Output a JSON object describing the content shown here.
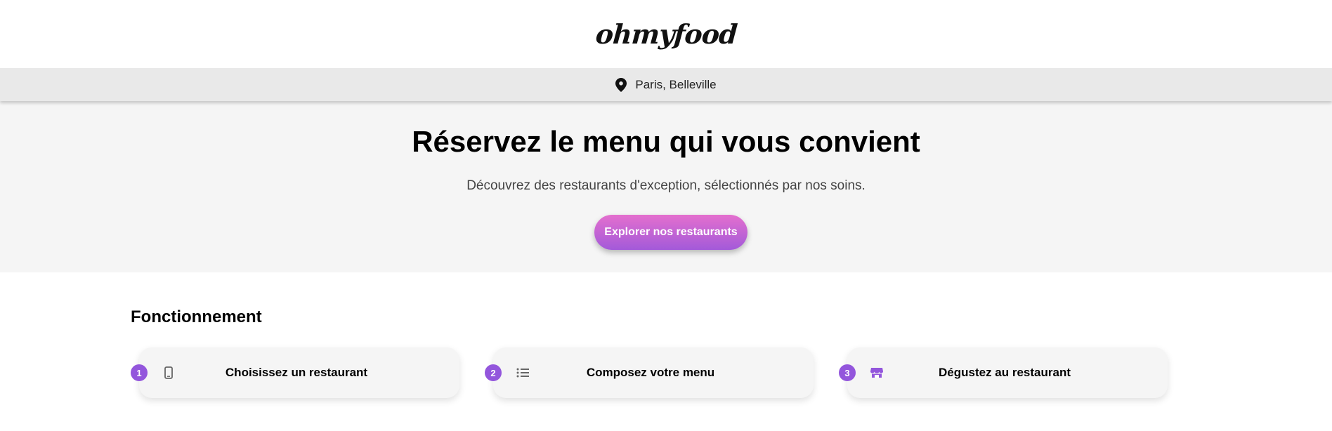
{
  "header": {
    "logo": "ohmyfood"
  },
  "location": {
    "text": "Paris, Belleville",
    "icon": "map-pin-icon"
  },
  "hero": {
    "title": "Réservez le menu qui vous convient",
    "subtitle": "Découvrez des restaurants d'exception, sélectionnés par nos soins.",
    "cta_label": "Explorer nos restaurants"
  },
  "how_it_works": {
    "title": "Fonctionnement",
    "steps": [
      {
        "number": "1",
        "label": "Choisissez un restaurant",
        "icon": "mobile-phone-icon"
      },
      {
        "number": "2",
        "label": "Composez votre menu",
        "icon": "list-icon"
      },
      {
        "number": "3",
        "label": "Dégustez au restaurant",
        "icon": "store-icon"
      }
    ]
  },
  "colors": {
    "accent": "#9356dc",
    "gradient_start": "#e46fce",
    "gradient_end": "#a35ad9",
    "hero_bg": "#f5f5f5",
    "location_bg": "#e9e9e9"
  }
}
